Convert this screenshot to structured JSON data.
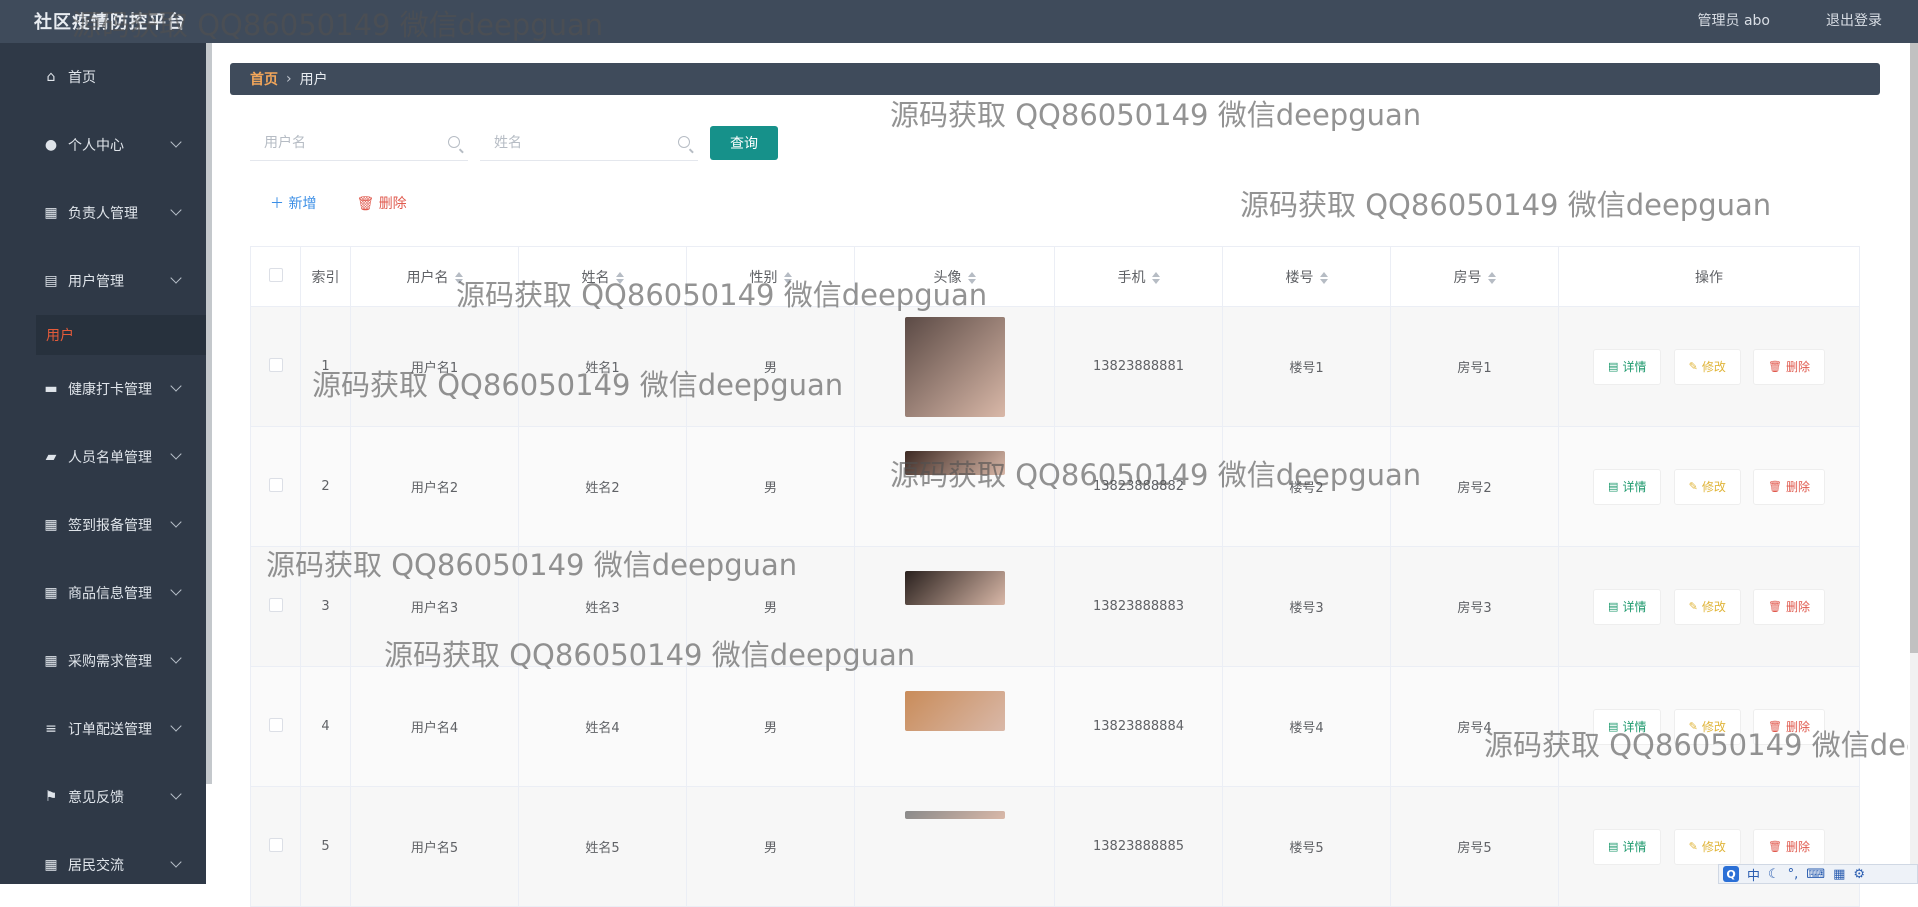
{
  "header": {
    "title": "社区疫情防控平台",
    "user_label": "管理员 abo",
    "logout_label": "退出登录"
  },
  "sidebar": {
    "items": [
      {
        "label": "首页",
        "icon": "home-icon",
        "has_children": false
      },
      {
        "label": "个人中心",
        "icon": "person-icon",
        "has_children": true
      },
      {
        "label": "负责人管理",
        "icon": "grid-icon",
        "has_children": true
      },
      {
        "label": "用户管理",
        "icon": "clipboard-icon",
        "has_children": true
      },
      {
        "label": "健康打卡管理",
        "icon": "briefcase-icon",
        "has_children": true
      },
      {
        "label": "人员名单管理",
        "icon": "comment-icon",
        "has_children": true
      },
      {
        "label": "签到报备管理",
        "icon": "grid-icon",
        "has_children": true
      },
      {
        "label": "商品信息管理",
        "icon": "grid-icon",
        "has_children": true
      },
      {
        "label": "采购需求管理",
        "icon": "grid-icon",
        "has_children": true
      },
      {
        "label": "订单配送管理",
        "icon": "list-icon",
        "has_children": true
      },
      {
        "label": "意见反馈",
        "icon": "flag-icon",
        "has_children": true
      },
      {
        "label": "居民交流",
        "icon": "grid-icon",
        "has_children": true
      }
    ],
    "active_sub": "用户"
  },
  "breadcrumb": {
    "home": "首页",
    "current": "用户"
  },
  "search": {
    "username_placeholder": "用户名",
    "name_placeholder": "姓名",
    "button_label": "查询"
  },
  "actions": {
    "add_label": "新增",
    "delete_label": "删除"
  },
  "table": {
    "headers": {
      "index": "索引",
      "username": "用户名",
      "name": "姓名",
      "gender": "性别",
      "avatar": "头像",
      "phone": "手机",
      "building": "楼号",
      "room": "房号",
      "ops": "操作"
    },
    "row_buttons": {
      "detail": "详情",
      "edit": "修改",
      "delete": "删除"
    },
    "rows": [
      {
        "index": "1",
        "username": "用户名1",
        "name": "姓名1",
        "gender": "男",
        "phone": "13823888881",
        "building": "楼号1",
        "room": "房号1"
      },
      {
        "index": "2",
        "username": "用户名2",
        "name": "姓名2",
        "gender": "男",
        "phone": "13823888882",
        "building": "楼号2",
        "room": "房号2"
      },
      {
        "index": "3",
        "username": "用户名3",
        "name": "姓名3",
        "gender": "男",
        "phone": "13823888883",
        "building": "楼号3",
        "room": "房号3"
      },
      {
        "index": "4",
        "username": "用户名4",
        "name": "姓名4",
        "gender": "男",
        "phone": "13823888884",
        "building": "楼号4",
        "room": "房号4"
      },
      {
        "index": "5",
        "username": "用户名5",
        "name": "姓名5",
        "gender": "男",
        "phone": "13823888885",
        "building": "楼号5",
        "room": "房号5"
      }
    ]
  },
  "watermark": "源码获取 QQ86050149 微信deepguan",
  "ime": {
    "mode": "中"
  },
  "colors": {
    "topbar": "#3f4b5b",
    "sidebar": "#2f3947",
    "accent": "#16918a",
    "active": "#e55b3a"
  }
}
